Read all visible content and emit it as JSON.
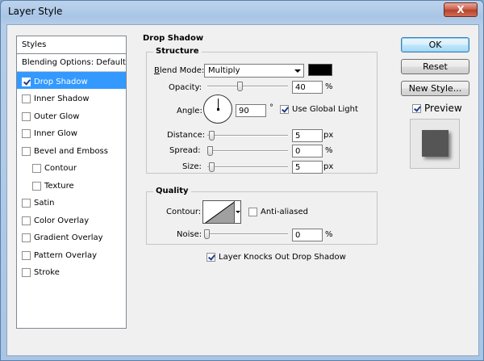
{
  "window": {
    "title": "Layer Style",
    "close_label": "X"
  },
  "styles": {
    "header": "Styles",
    "items": [
      {
        "label": "Blending Options: Default",
        "checkbox": false,
        "checked": false,
        "selected": false,
        "indent": false
      },
      {
        "label": "Drop Shadow",
        "checkbox": true,
        "checked": true,
        "selected": true,
        "indent": false
      },
      {
        "label": "Inner Shadow",
        "checkbox": true,
        "checked": false,
        "selected": false,
        "indent": false
      },
      {
        "label": "Outer Glow",
        "checkbox": true,
        "checked": false,
        "selected": false,
        "indent": false
      },
      {
        "label": "Inner Glow",
        "checkbox": true,
        "checked": false,
        "selected": false,
        "indent": false
      },
      {
        "label": "Bevel and Emboss",
        "checkbox": true,
        "checked": false,
        "selected": false,
        "indent": false
      },
      {
        "label": "Contour",
        "checkbox": true,
        "checked": false,
        "selected": false,
        "indent": true
      },
      {
        "label": "Texture",
        "checkbox": true,
        "checked": false,
        "selected": false,
        "indent": true
      },
      {
        "label": "Satin",
        "checkbox": true,
        "checked": false,
        "selected": false,
        "indent": false
      },
      {
        "label": "Color Overlay",
        "checkbox": true,
        "checked": false,
        "selected": false,
        "indent": false
      },
      {
        "label": "Gradient Overlay",
        "checkbox": true,
        "checked": false,
        "selected": false,
        "indent": false
      },
      {
        "label": "Pattern Overlay",
        "checkbox": true,
        "checked": false,
        "selected": false,
        "indent": false
      },
      {
        "label": "Stroke",
        "checkbox": true,
        "checked": false,
        "selected": false,
        "indent": false
      }
    ]
  },
  "drop_shadow": {
    "title": "Drop Shadow",
    "structure": {
      "title": "Structure",
      "blend_mode_label": "Blend Mode:",
      "blend_mode_value": "Multiply",
      "blend_color": "#000000",
      "opacity_label": "Opacity:",
      "opacity_value": "40",
      "opacity_unit": "%",
      "opacity_fraction": 0.4,
      "angle_label": "Angle:",
      "angle_value": "90",
      "angle_unit": "°",
      "use_global_light_label": "Use Global Light",
      "use_global_light_checked": true,
      "distance_label": "Distance:",
      "distance_value": "5",
      "distance_unit": "px",
      "distance_fraction": 0.02,
      "spread_label": "Spread:",
      "spread_value": "0",
      "spread_unit": "%",
      "spread_fraction": 0.0,
      "size_label": "Size:",
      "size_value": "5",
      "size_unit": "px",
      "size_fraction": 0.02
    },
    "quality": {
      "title": "Quality",
      "contour_label": "Contour:",
      "anti_aliased_label": "Anti-aliased",
      "anti_aliased_checked": false,
      "noise_label": "Noise:",
      "noise_value": "0",
      "noise_unit": "%",
      "noise_fraction": 0.0
    },
    "knockout_label": "Layer Knocks Out Drop Shadow",
    "knockout_checked": true
  },
  "buttons": {
    "ok": "OK",
    "reset": "Reset",
    "new_style": "New Style...",
    "preview_label": "Preview",
    "preview_checked": true
  }
}
